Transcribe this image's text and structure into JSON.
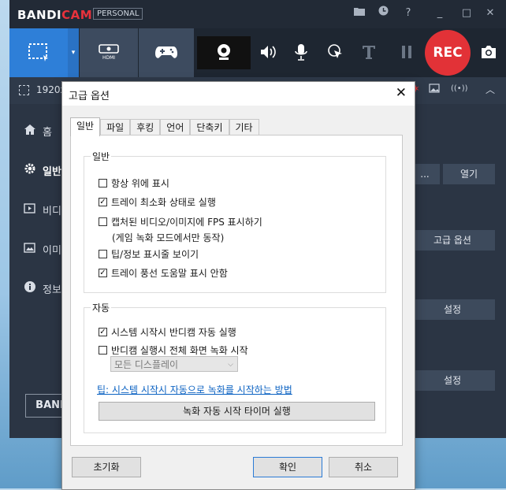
{
  "app": {
    "logo_main": "BANDI",
    "logo_accent": "CAM",
    "edition": "PERSONAL",
    "rec_label": "REC",
    "resolution": "1920x",
    "sidebar": [
      {
        "label": "홈",
        "icon": "home-icon"
      },
      {
        "label": "일반",
        "icon": "gear-icon"
      },
      {
        "label": "비디",
        "icon": "video-icon"
      },
      {
        "label": "이미",
        "icon": "image-icon"
      },
      {
        "label": "정보",
        "icon": "info-icon"
      }
    ],
    "right_buttons": {
      "dots": "...",
      "open": "열기",
      "advanced": "고급 옵션",
      "settings1": "설정",
      "settings2": "설정"
    },
    "bandi_button": "BANI"
  },
  "dialog": {
    "title": "고급 옵션",
    "tabs": [
      "일반",
      "파일",
      "후킹",
      "언어",
      "단축키",
      "기타"
    ],
    "active_tab": 0,
    "general_group": {
      "label": "일반",
      "options": [
        {
          "label": "항상 위에 표시",
          "checked": false
        },
        {
          "label": "트레이 최소화 상태로 실행",
          "checked": true
        },
        {
          "label": "캡처된 비디오/이미지에 FPS 표시하기",
          "checked": false
        },
        {
          "label": "팁/정보 표시줄 보이기",
          "checked": false
        },
        {
          "label": "트레이 풍선 도움말 표시 안함",
          "checked": true
        }
      ],
      "fps_note": "(게임 녹화 모드에서만 동작)"
    },
    "auto_group": {
      "label": "자동",
      "options": [
        {
          "label": "시스템 시작시 반디캠 자동 실행",
          "checked": true
        },
        {
          "label": "반디캠 실행시 전체 화면 녹화 시작",
          "checked": false
        }
      ],
      "display_select": "모든 디스플레이",
      "tip_link": "팁: 시스템 시작시 자동으로 녹화를 시작하는 방법",
      "timer_button": "녹화 자동 시작 타이머 실행"
    },
    "buttons": {
      "reset": "초기화",
      "ok": "확인",
      "cancel": "취소"
    }
  },
  "check_mark": "✓"
}
